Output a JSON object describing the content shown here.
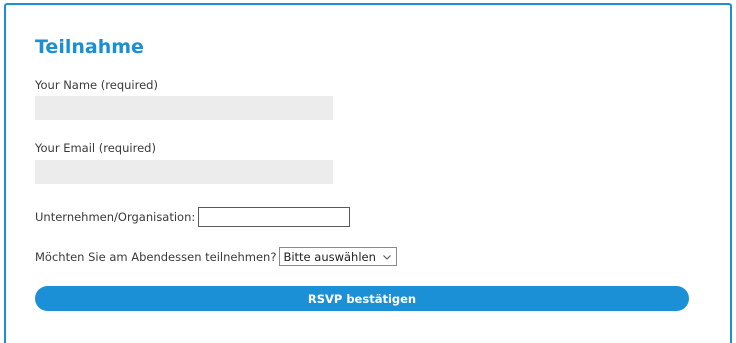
{
  "form": {
    "title": "Teilnahme",
    "name_label": "Your Name (required)",
    "name_value": "",
    "email_label": "Your Email (required)",
    "email_value": "",
    "org_label": "Unternehmen/Organisation:",
    "org_value": "",
    "dinner_label": "Möchten Sie am Abendessen teilnehmen?",
    "dinner_selected": "Bitte auswählen",
    "submit_label": "RSVP bestätigen"
  },
  "colors": {
    "accent": "#1a8fd3",
    "field_background": "#ececec"
  },
  "icons": {
    "select_arrow": "chevron-down-icon"
  }
}
